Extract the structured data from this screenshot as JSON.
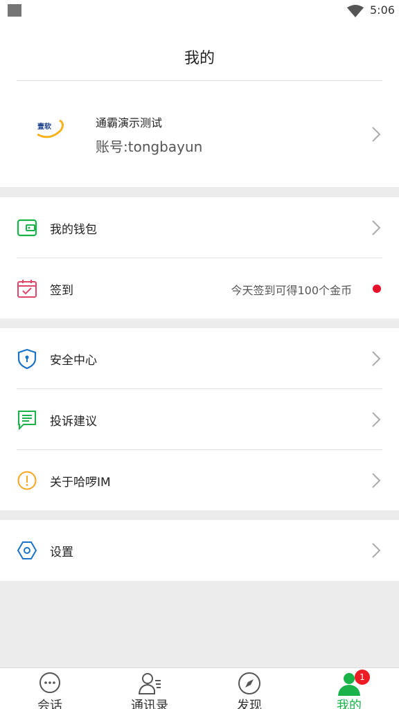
{
  "status_bar": {
    "time": "5:06"
  },
  "header": {
    "title": "我的"
  },
  "profile": {
    "logo_text": "壹软",
    "name": "通霸演示测试",
    "account": "账号:tongbayun"
  },
  "menu": {
    "wallet": {
      "label": "我的钱包",
      "icon": "wallet-icon"
    },
    "checkin": {
      "label": "签到",
      "hint": "今天签到可得100个金币",
      "icon": "calendar-icon"
    },
    "security": {
      "label": "安全中心",
      "icon": "shield-icon"
    },
    "feedback": {
      "label": "投诉建议",
      "icon": "message-icon"
    },
    "about": {
      "label": "关于哈啰IM",
      "icon": "info-icon"
    },
    "settings": {
      "label": "设置",
      "icon": "gear-icon"
    }
  },
  "tabbar": {
    "tabs": [
      {
        "label": "会话",
        "icon": "chat-icon"
      },
      {
        "label": "通讯录",
        "icon": "contacts-icon"
      },
      {
        "label": "发现",
        "icon": "compass-icon"
      },
      {
        "label": "我的",
        "icon": "person-icon",
        "badge": "1",
        "active": true
      }
    ]
  },
  "colors": {
    "accent_green": "#19b34a",
    "badge_red": "#ee1c25",
    "shield_blue": "#1a73c7",
    "calendar_pink": "#e0456a",
    "info_orange": "#f5a623"
  }
}
